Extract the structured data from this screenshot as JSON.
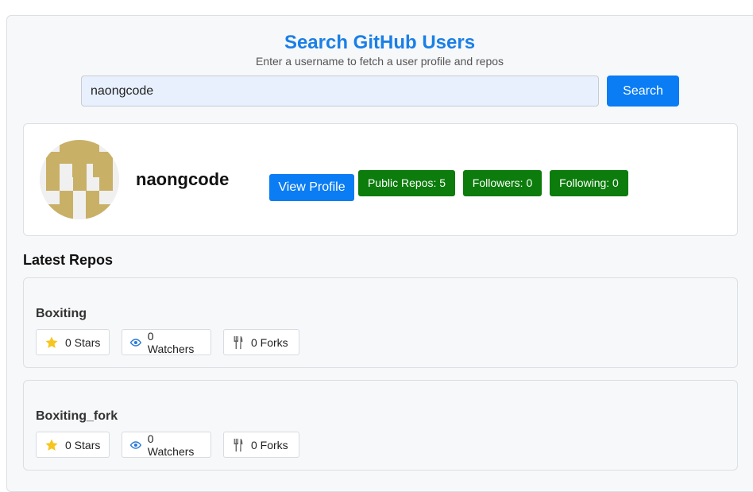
{
  "header": {
    "title": "Search GitHub Users",
    "subtitle": "Enter a username to fetch a user profile and repos"
  },
  "search": {
    "value": "naongcode",
    "button_label": "Search"
  },
  "profile": {
    "username": "naongcode",
    "view_profile_label": "View Profile",
    "public_repos_label": "Public Repos: 5",
    "followers_label": "Followers: 0",
    "following_label": "Following: 0"
  },
  "repos_section": {
    "title": "Latest Repos",
    "repos": [
      {
        "name": "Boxiting",
        "stars": "0 Stars",
        "watchers": "0 Watchers",
        "forks": "0 Forks"
      },
      {
        "name": "Boxiting_fork",
        "stars": "0 Stars",
        "watchers": "0 Watchers",
        "forks": "0 Forks"
      }
    ]
  },
  "colors": {
    "accent": "#0a7cf4",
    "title": "#1a7fe6",
    "badge": "#0c7c0c",
    "avatar_block": "#c9b067"
  },
  "icons": {
    "stars": "star-icon",
    "watchers": "eye-icon",
    "forks": "fork-icon"
  }
}
